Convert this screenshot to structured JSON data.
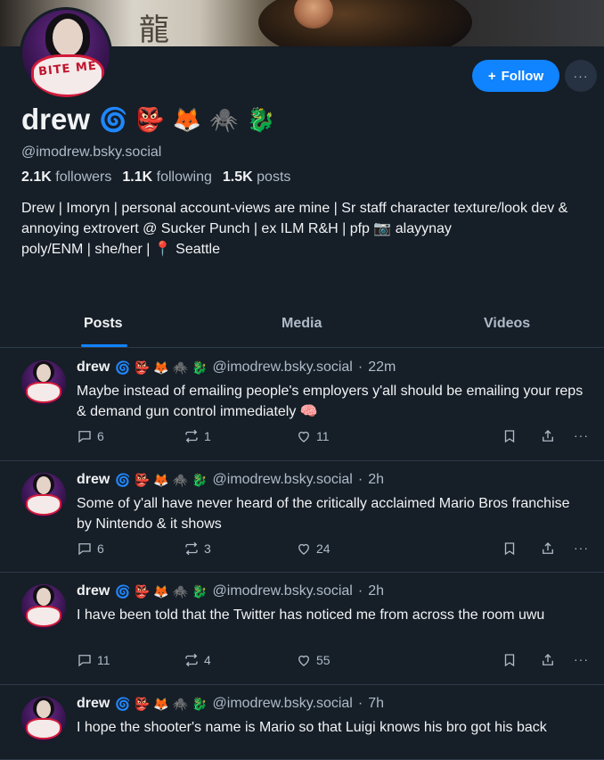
{
  "profile": {
    "display_name": "drew",
    "name_emojis": [
      "🌀",
      "👺",
      "🦊",
      "🕷️",
      "🐉"
    ],
    "handle": "@imodrew.bsky.social",
    "followers_count": "2.1K",
    "followers_label": "followers",
    "following_count": "1.1K",
    "following_label": "following",
    "posts_count": "1.5K",
    "posts_label": "posts",
    "bio_line1": "Drew | Imoryn | personal account-views are mine | Sr staff character texture/look dev & annoying extrovert @ Sucker Punch | ex ILM R&H | pfp 📷 alayynay",
    "bio_line2": "poly/ENM | she/her | 📍 Seattle",
    "avatar_text": "BITE ME",
    "banner_glyph": "龍"
  },
  "actions": {
    "follow_label": "Follow",
    "follow_icon": "+",
    "more_icon": "···"
  },
  "tabs": [
    {
      "label": "Posts",
      "active": true
    },
    {
      "label": "Media",
      "active": false
    },
    {
      "label": "Videos",
      "active": false
    }
  ],
  "posts": [
    {
      "author": "drew",
      "handle": "@imodrew.bsky.social",
      "time": "22m",
      "text": "Maybe instead of emailing people's employers y'all should be emailing your reps & demand gun control immediately 🧠",
      "replies": "6",
      "reposts": "1",
      "likes": "11"
    },
    {
      "author": "drew",
      "handle": "@imodrew.bsky.social",
      "time": "2h",
      "text": "Some of y'all have never heard of the critically acclaimed Mario Bros franchise by Nintendo & it shows",
      "replies": "6",
      "reposts": "3",
      "likes": "24"
    },
    {
      "author": "drew",
      "handle": "@imodrew.bsky.social",
      "time": "2h",
      "text": "I have been told that the Twitter has noticed me from across the room uwu",
      "replies": "11",
      "reposts": "4",
      "likes": "55"
    },
    {
      "author": "drew",
      "handle": "@imodrew.bsky.social",
      "time": "7h",
      "text": "I hope the shooter's name is Mario so that Luigi knows his bro got his back",
      "replies": "",
      "reposts": "",
      "likes": ""
    }
  ],
  "colors": {
    "background": "#161e27",
    "accent": "#1083fe",
    "muted_text": "#aebbc9",
    "border": "#2e3b4a"
  }
}
